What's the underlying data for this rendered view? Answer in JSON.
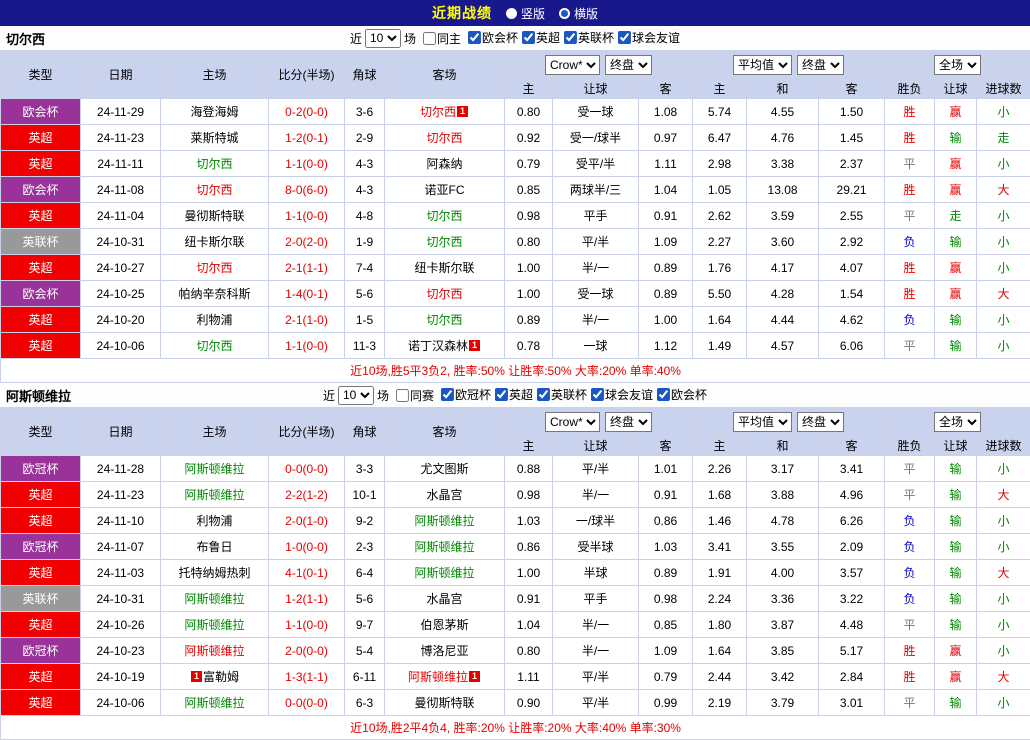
{
  "palette": {
    "topbar_bg": "#18188c",
    "title_yellow": "#ffff00",
    "header_bg": "#c9d3ee",
    "border": "#c9d2e8",
    "text_colors": {
      "red": "#e60000",
      "green": "#008800",
      "blue": "#0000cc",
      "gray": "#777777",
      "black": "#000000"
    },
    "league_colors": {
      "purple": "#993399",
      "red": "#f00000",
      "gray": "#999999"
    },
    "score_color": "#e60000",
    "summary_color": "#e60000"
  },
  "topbar": {
    "title": "近期战绩",
    "vertical_label": "竖版",
    "horizontal_label": "横版",
    "selected": "横版"
  },
  "header_labels": {
    "base": [
      "类型",
      "日期",
      "主场",
      "比分(半场)",
      "角球",
      "客场"
    ],
    "odds_select_1": "Crow*",
    "odds_select_2": "终盘",
    "avg_select_1": "平均值",
    "avg_select_2": "终盘",
    "full_select": "全场",
    "odds_sub": [
      "主",
      "让球",
      "客"
    ],
    "avg_sub": [
      "主",
      "和",
      "客"
    ],
    "result_sub": [
      "胜负",
      "让球",
      "进球数"
    ]
  },
  "row_fields": [
    "league",
    "leagueClass",
    "date",
    "home",
    "homeColor",
    "homeBadge",
    "score",
    "corner",
    "away",
    "awayColor",
    "awayBadge",
    "oddsHome",
    "oddsHandicap",
    "oddsAway",
    "avgHome",
    "avgDraw",
    "avgAway",
    "resultWdl",
    "resultWdlColor",
    "resultHandicap",
    "resultHandicapColor",
    "resultGoals",
    "resultGoalsColor"
  ],
  "sections": [
    {
      "team": "切尔西",
      "filter": {
        "pre": "近",
        "count": "10",
        "post": "场",
        "same": "同主",
        "same_checked": false,
        "leagues": [
          "欧会杯",
          "英超",
          "英联杯",
          "球会友谊"
        ]
      },
      "rows": [
        [
          "欧会杯",
          "purple",
          "24-11-29",
          "海登海姆",
          "black",
          "",
          "0-2(0-0)",
          "3-6",
          "切尔西",
          "red",
          "post",
          "0.80",
          "受一球",
          "1.08",
          "5.74",
          "4.55",
          "1.50",
          "胜",
          "red",
          "赢",
          "red",
          "小",
          "green"
        ],
        [
          "英超",
          "red",
          "24-11-23",
          "莱斯特城",
          "black",
          "",
          "1-2(0-1)",
          "2-9",
          "切尔西",
          "red",
          "",
          "0.92",
          "受一/球半",
          "0.97",
          "6.47",
          "4.76",
          "1.45",
          "胜",
          "red",
          "输",
          "green",
          "走",
          "green"
        ],
        [
          "英超",
          "red",
          "24-11-11",
          "切尔西",
          "green",
          "",
          "1-1(0-0)",
          "4-3",
          "阿森纳",
          "black",
          "",
          "0.79",
          "受平/半",
          "1.11",
          "2.98",
          "3.38",
          "2.37",
          "平",
          "gray",
          "赢",
          "red",
          "小",
          "green"
        ],
        [
          "欧会杯",
          "purple",
          "24-11-08",
          "切尔西",
          "red",
          "",
          "8-0(6-0)",
          "4-3",
          "诺亚FC",
          "black",
          "",
          "0.85",
          "两球半/三",
          "1.04",
          "1.05",
          "13.08",
          "29.21",
          "胜",
          "red",
          "赢",
          "red",
          "大",
          "red"
        ],
        [
          "英超",
          "red",
          "24-11-04",
          "曼彻斯特联",
          "black",
          "",
          "1-1(0-0)",
          "4-8",
          "切尔西",
          "green",
          "",
          "0.98",
          "平手",
          "0.91",
          "2.62",
          "3.59",
          "2.55",
          "平",
          "gray",
          "走",
          "green",
          "小",
          "green"
        ],
        [
          "英联杯",
          "gray",
          "24-10-31",
          "纽卡斯尔联",
          "black",
          "",
          "2-0(2-0)",
          "1-9",
          "切尔西",
          "green",
          "",
          "0.80",
          "平/半",
          "1.09",
          "2.27",
          "3.60",
          "2.92",
          "负",
          "blue",
          "输",
          "green",
          "小",
          "green"
        ],
        [
          "英超",
          "red",
          "24-10-27",
          "切尔西",
          "red",
          "",
          "2-1(1-1)",
          "7-4",
          "纽卡斯尔联",
          "black",
          "",
          "1.00",
          "半/一",
          "0.89",
          "1.76",
          "4.17",
          "4.07",
          "胜",
          "red",
          "赢",
          "red",
          "小",
          "green"
        ],
        [
          "欧会杯",
          "purple",
          "24-10-25",
          "帕纳辛奈科斯",
          "black",
          "",
          "1-4(0-1)",
          "5-6",
          "切尔西",
          "red",
          "",
          "1.00",
          "受一球",
          "0.89",
          "5.50",
          "4.28",
          "1.54",
          "胜",
          "red",
          "赢",
          "red",
          "大",
          "red"
        ],
        [
          "英超",
          "red",
          "24-10-20",
          "利物浦",
          "black",
          "",
          "2-1(1-0)",
          "1-5",
          "切尔西",
          "green",
          "",
          "0.89",
          "半/一",
          "1.00",
          "1.64",
          "4.44",
          "4.62",
          "负",
          "blue",
          "输",
          "green",
          "小",
          "green"
        ],
        [
          "英超",
          "red",
          "24-10-06",
          "切尔西",
          "green",
          "",
          "1-1(0-0)",
          "11-3",
          "诺丁汉森林",
          "black",
          "post",
          "0.78",
          "一球",
          "1.12",
          "1.49",
          "4.57",
          "6.06",
          "平",
          "gray",
          "输",
          "green",
          "小",
          "green"
        ]
      ],
      "summary": "近10场,胜5平3负2, 胜率:50% 让胜率:50% 大率:20% 单率:40%"
    },
    {
      "team": "阿斯顿维拉",
      "filter": {
        "pre": "近",
        "count": "10",
        "post": "场",
        "same": "同赛",
        "same_checked": false,
        "leagues": [
          "欧冠杯",
          "英超",
          "英联杯",
          "球会友谊",
          "欧会杯"
        ]
      },
      "rows": [
        [
          "欧冠杯",
          "purple",
          "24-11-28",
          "阿斯顿维拉",
          "green",
          "",
          "0-0(0-0)",
          "3-3",
          "尤文图斯",
          "black",
          "",
          "0.88",
          "平/半",
          "1.01",
          "2.26",
          "3.17",
          "3.41",
          "平",
          "gray",
          "输",
          "green",
          "小",
          "green"
        ],
        [
          "英超",
          "red",
          "24-11-23",
          "阿斯顿维拉",
          "green",
          "",
          "2-2(1-2)",
          "10-1",
          "水晶宫",
          "black",
          "",
          "0.98",
          "半/一",
          "0.91",
          "1.68",
          "3.88",
          "4.96",
          "平",
          "gray",
          "输",
          "green",
          "大",
          "red"
        ],
        [
          "英超",
          "red",
          "24-11-10",
          "利物浦",
          "black",
          "",
          "2-0(1-0)",
          "9-2",
          "阿斯顿维拉",
          "green",
          "",
          "1.03",
          "一/球半",
          "0.86",
          "1.46",
          "4.78",
          "6.26",
          "负",
          "blue",
          "输",
          "green",
          "小",
          "green"
        ],
        [
          "欧冠杯",
          "purple",
          "24-11-07",
          "布鲁日",
          "black",
          "",
          "1-0(0-0)",
          "2-3",
          "阿斯顿维拉",
          "green",
          "",
          "0.86",
          "受半球",
          "1.03",
          "3.41",
          "3.55",
          "2.09",
          "负",
          "blue",
          "输",
          "green",
          "小",
          "green"
        ],
        [
          "英超",
          "red",
          "24-11-03",
          "托特纳姆热刺",
          "black",
          "",
          "4-1(0-1)",
          "6-4",
          "阿斯顿维拉",
          "green",
          "",
          "1.00",
          "半球",
          "0.89",
          "1.91",
          "4.00",
          "3.57",
          "负",
          "blue",
          "输",
          "green",
          "大",
          "red"
        ],
        [
          "英联杯",
          "gray",
          "24-10-31",
          "阿斯顿维拉",
          "green",
          "",
          "1-2(1-1)",
          "5-6",
          "水晶宫",
          "black",
          "",
          "0.91",
          "平手",
          "0.98",
          "2.24",
          "3.36",
          "3.22",
          "负",
          "blue",
          "输",
          "green",
          "小",
          "green"
        ],
        [
          "英超",
          "red",
          "24-10-26",
          "阿斯顿维拉",
          "green",
          "",
          "1-1(0-0)",
          "9-7",
          "伯恩茅斯",
          "black",
          "",
          "1.04",
          "半/一",
          "0.85",
          "1.80",
          "3.87",
          "4.48",
          "平",
          "gray",
          "输",
          "green",
          "小",
          "green"
        ],
        [
          "欧冠杯",
          "purple",
          "24-10-23",
          "阿斯顿维拉",
          "red",
          "",
          "2-0(0-0)",
          "5-4",
          "博洛尼亚",
          "black",
          "",
          "0.80",
          "半/一",
          "1.09",
          "1.64",
          "3.85",
          "5.17",
          "胜",
          "red",
          "赢",
          "red",
          "小",
          "green"
        ],
        [
          "英超",
          "red",
          "24-10-19",
          "富勒姆",
          "black",
          "pre",
          "1-3(1-1)",
          "6-11",
          "阿斯顿维拉",
          "red",
          "post",
          "1.11",
          "平/半",
          "0.79",
          "2.44",
          "3.42",
          "2.84",
          "胜",
          "red",
          "赢",
          "red",
          "大",
          "red"
        ],
        [
          "英超",
          "red",
          "24-10-06",
          "阿斯顿维拉",
          "green",
          "",
          "0-0(0-0)",
          "6-3",
          "曼彻斯特联",
          "black",
          "",
          "0.90",
          "平/半",
          "0.99",
          "2.19",
          "3.79",
          "3.01",
          "平",
          "gray",
          "输",
          "green",
          "小",
          "green"
        ]
      ],
      "summary": "近10场,胜2平4负4, 胜率:20% 让胜率:20% 大率:40% 单率:30%"
    }
  ]
}
